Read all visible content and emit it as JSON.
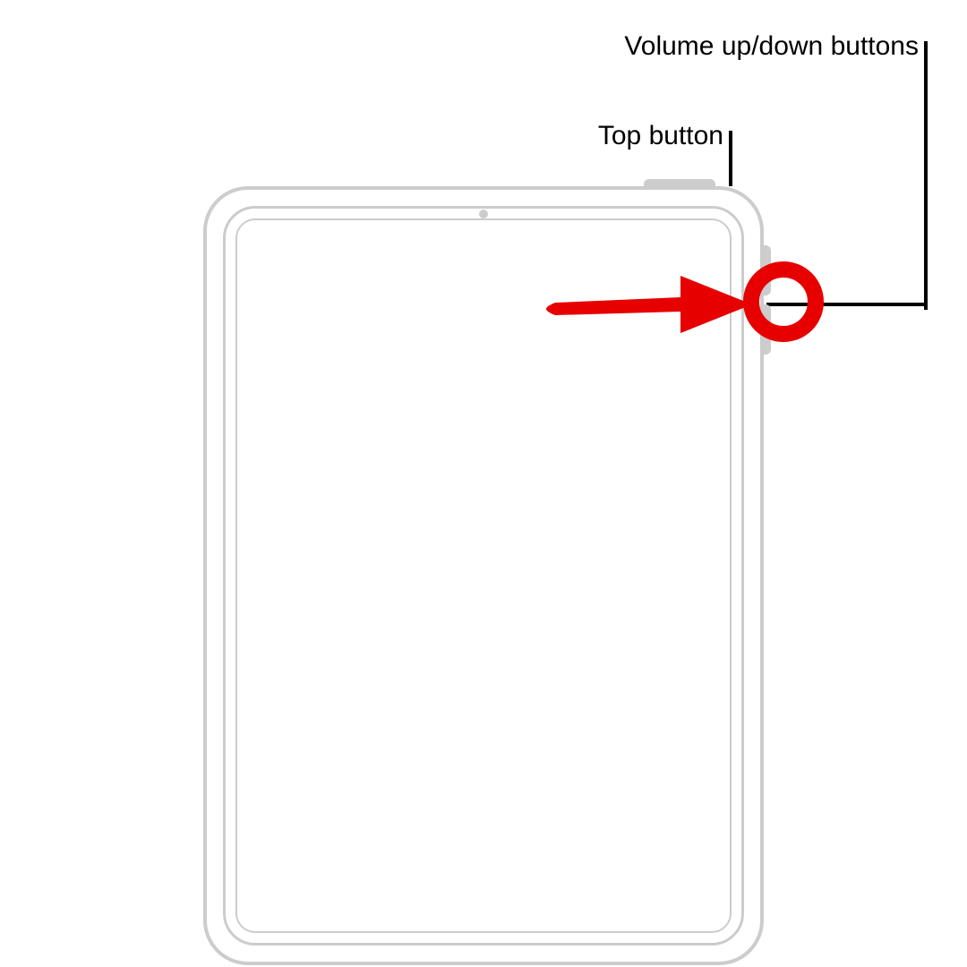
{
  "labels": {
    "volume": "Volume up/down buttons",
    "top_button": "Top button"
  },
  "highlight": {
    "color": "#e60000",
    "target": "volume-buttons"
  },
  "device": {
    "type": "iPad",
    "outline_color": "#cccccc"
  }
}
